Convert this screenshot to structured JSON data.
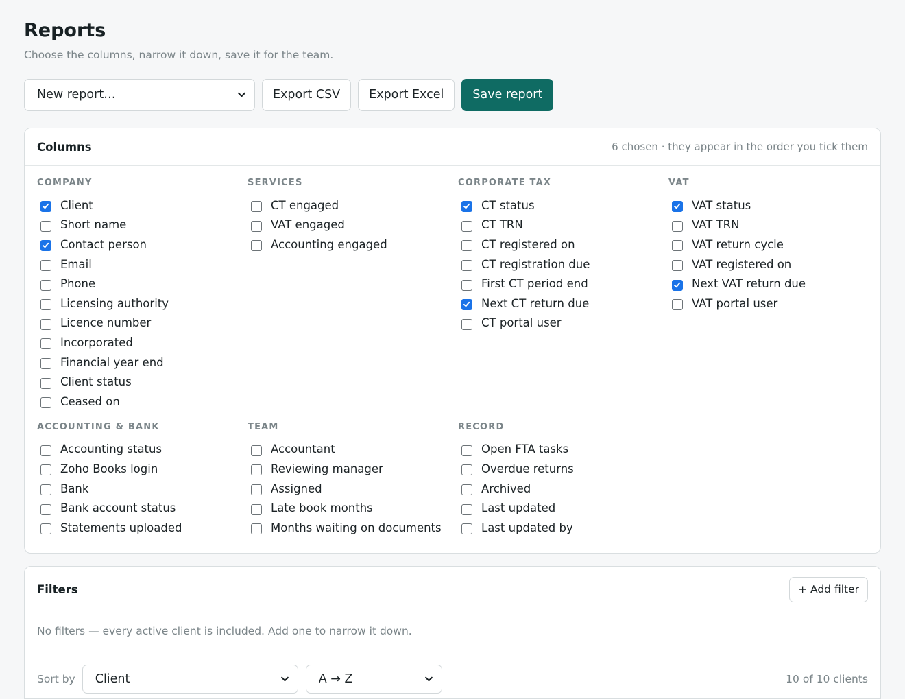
{
  "page": {
    "title": "Reports",
    "subtitle": "Choose the columns, narrow it down, save it for the team."
  },
  "toolbar": {
    "report_select": "New report…",
    "export_csv": "Export CSV",
    "export_excel": "Export Excel",
    "save_report": "Save report",
    "primary_color": "#0f6b63"
  },
  "columns": {
    "title": "Columns",
    "hint": "6 chosen · they appear in the order you tick them",
    "groups": [
      {
        "title": "COMPANY",
        "options": [
          {
            "label": "Client",
            "checked": true
          },
          {
            "label": "Short name",
            "checked": false
          },
          {
            "label": "Contact person",
            "checked": true
          },
          {
            "label": "Email",
            "checked": false
          },
          {
            "label": "Phone",
            "checked": false
          },
          {
            "label": "Licensing authority",
            "checked": false
          },
          {
            "label": "Licence number",
            "checked": false
          },
          {
            "label": "Incorporated",
            "checked": false
          },
          {
            "label": "Financial year end",
            "checked": false
          },
          {
            "label": "Client status",
            "checked": false
          },
          {
            "label": "Ceased on",
            "checked": false
          }
        ]
      },
      {
        "title": "SERVICES",
        "options": [
          {
            "label": "CT engaged",
            "checked": false
          },
          {
            "label": "VAT engaged",
            "checked": false
          },
          {
            "label": "Accounting engaged",
            "checked": false
          }
        ]
      },
      {
        "title": "CORPORATE TAX",
        "options": [
          {
            "label": "CT status",
            "checked": true
          },
          {
            "label": "CT TRN",
            "checked": false
          },
          {
            "label": "CT registered on",
            "checked": false
          },
          {
            "label": "CT registration due",
            "checked": false
          },
          {
            "label": "First CT period end",
            "checked": false
          },
          {
            "label": "Next CT return due",
            "checked": true
          },
          {
            "label": "CT portal user",
            "checked": false
          }
        ]
      },
      {
        "title": "VAT",
        "options": [
          {
            "label": "VAT status",
            "checked": true
          },
          {
            "label": "VAT TRN",
            "checked": false
          },
          {
            "label": "VAT return cycle",
            "checked": false
          },
          {
            "label": "VAT registered on",
            "checked": false
          },
          {
            "label": "Next VAT return due",
            "checked": true
          },
          {
            "label": "VAT portal user",
            "checked": false
          }
        ]
      },
      {
        "title": "ACCOUNTING & BANK",
        "options": [
          {
            "label": "Accounting status",
            "checked": false
          },
          {
            "label": "Zoho Books login",
            "checked": false
          },
          {
            "label": "Bank",
            "checked": false
          },
          {
            "label": "Bank account status",
            "checked": false
          },
          {
            "label": "Statements uploaded",
            "checked": false
          }
        ]
      },
      {
        "title": "TEAM",
        "options": [
          {
            "label": "Accountant",
            "checked": false
          },
          {
            "label": "Reviewing manager",
            "checked": false
          },
          {
            "label": "Assigned",
            "checked": false
          },
          {
            "label": "Late book months",
            "checked": false
          },
          {
            "label": "Months waiting on documents",
            "checked": false
          }
        ]
      },
      {
        "title": "RECORD",
        "options": [
          {
            "label": "Open FTA tasks",
            "checked": false
          },
          {
            "label": "Overdue returns",
            "checked": false
          },
          {
            "label": "Archived",
            "checked": false
          },
          {
            "label": "Last updated",
            "checked": false
          },
          {
            "label": "Last updated by",
            "checked": false
          }
        ]
      }
    ]
  },
  "filters": {
    "title": "Filters",
    "add_filter": "+ Add filter",
    "empty_text": "No filters — every active client is included. Add one to narrow it down.",
    "sort_label": "Sort by",
    "sort_field": "Client",
    "sort_order": "A → Z",
    "count": "10 of 10 clients"
  }
}
